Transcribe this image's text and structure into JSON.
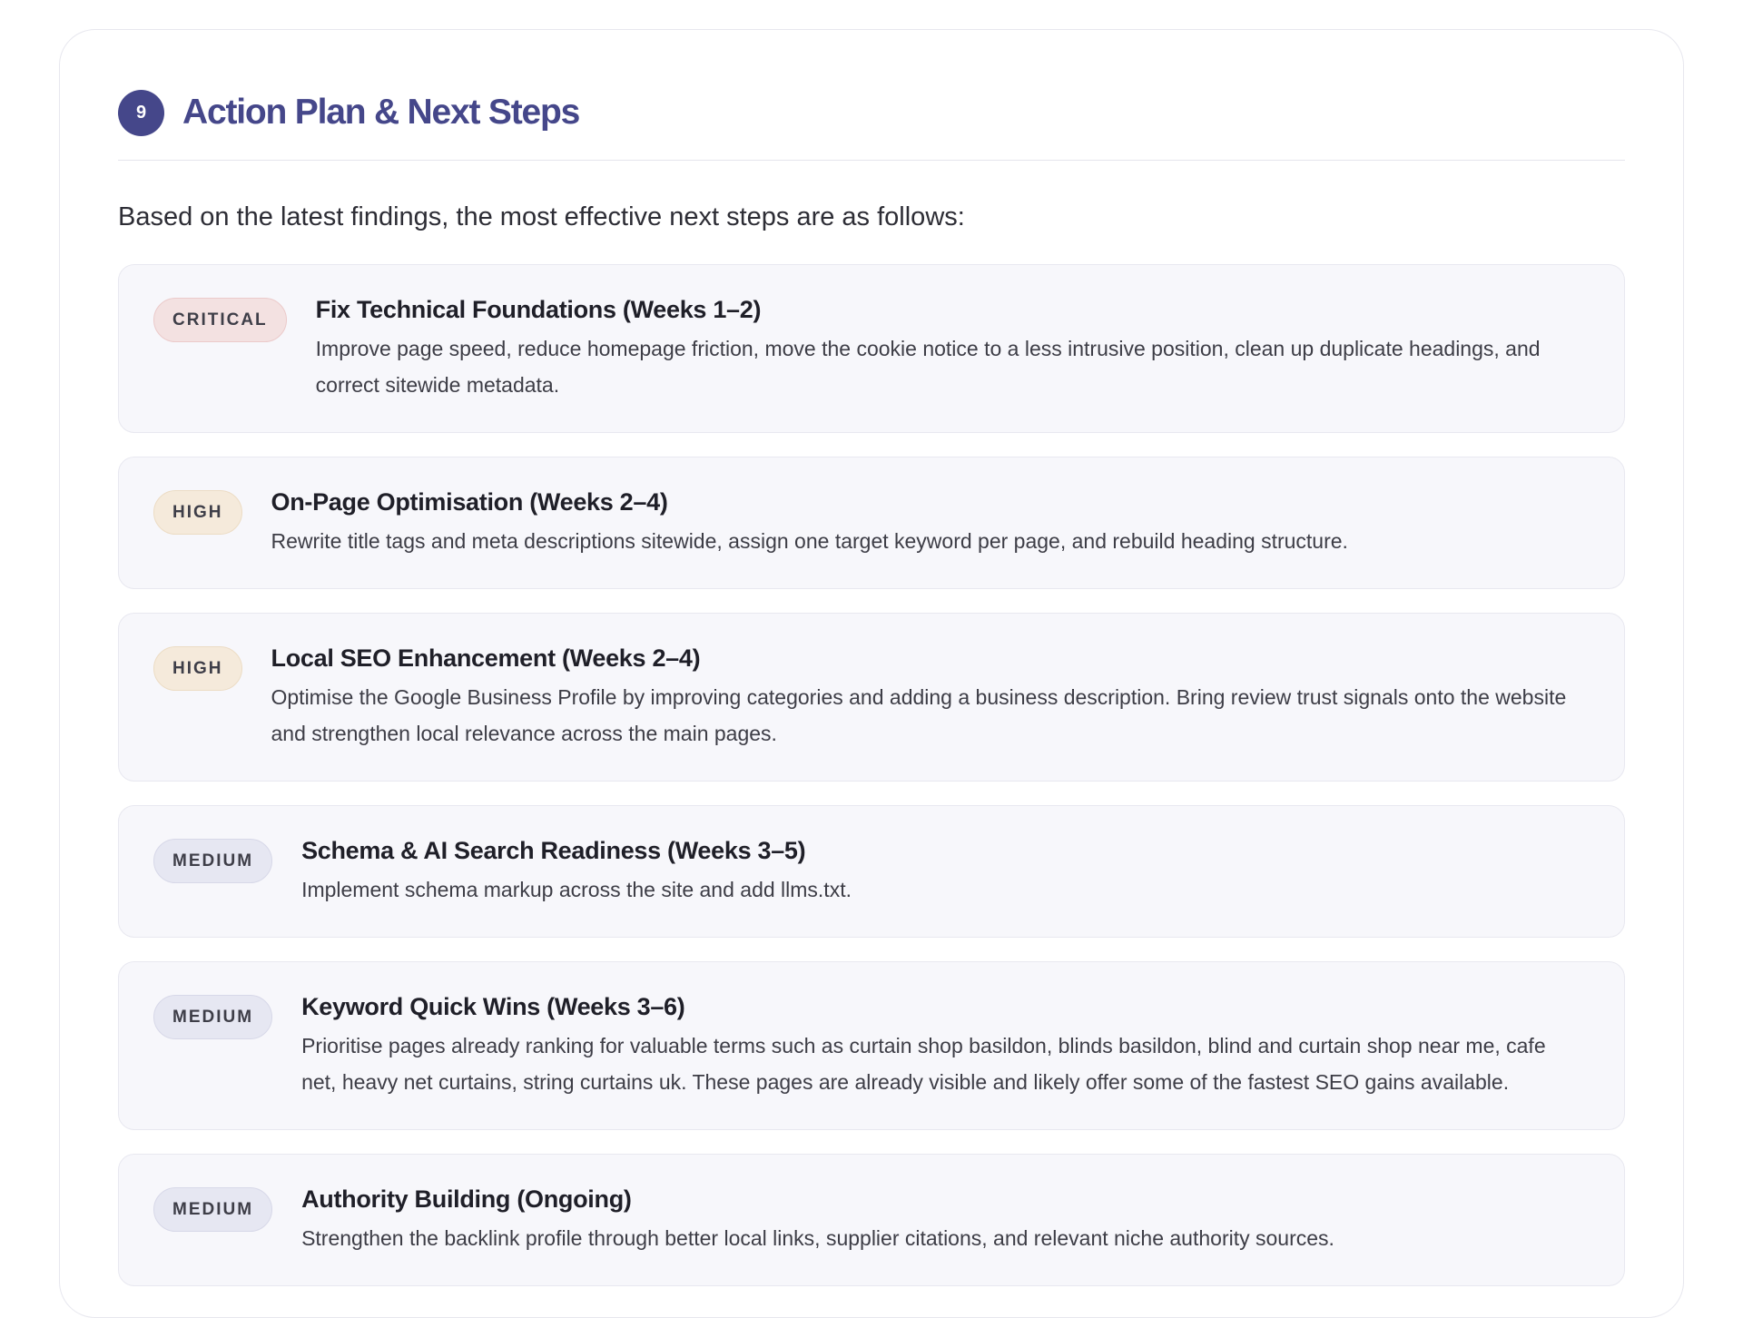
{
  "section": {
    "number": "9",
    "title": "Action Plan & Next Steps",
    "intro": "Based on the latest findings, the most effective next steps are as follows:"
  },
  "steps": [
    {
      "priority": "CRITICAL",
      "title": "Fix Technical Foundations (Weeks 1–2)",
      "description": "Improve page speed, reduce homepage friction, move the cookie notice to a less intrusive position, clean up duplicate headings, and correct sitewide metadata."
    },
    {
      "priority": "HIGH",
      "title": "On-Page Optimisation (Weeks 2–4)",
      "description": "Rewrite title tags and meta descriptions sitewide, assign one target keyword per page, and rebuild heading structure."
    },
    {
      "priority": "HIGH",
      "title": "Local SEO Enhancement (Weeks 2–4)",
      "description": "Optimise the Google Business Profile by improving categories and adding a business description. Bring review trust signals onto the website and strengthen local relevance across the main pages."
    },
    {
      "priority": "MEDIUM",
      "title": "Schema & AI Search Readiness (Weeks 3–5)",
      "description": "Implement schema markup across the site and add llms.txt."
    },
    {
      "priority": "MEDIUM",
      "title": "Keyword Quick Wins (Weeks 3–6)",
      "description": "Prioritise pages already ranking for valuable terms such as curtain shop basildon, blinds basildon, blind and curtain shop near me, cafe net, heavy net curtains, string curtains uk. These pages are already visible and likely offer some of the fastest SEO gains available."
    },
    {
      "priority": "MEDIUM",
      "title": "Authority Building (Ongoing)",
      "description": "Strengthen the backlink profile through better local links, supplier citations, and relevant niche authority sources."
    }
  ],
  "colors": {
    "accent": "#45478a",
    "critical_badge": "#f3e1e1",
    "high_badge": "#f5eadb",
    "medium_badge": "#e6e7f2",
    "card_background": "#f7f7fb"
  }
}
